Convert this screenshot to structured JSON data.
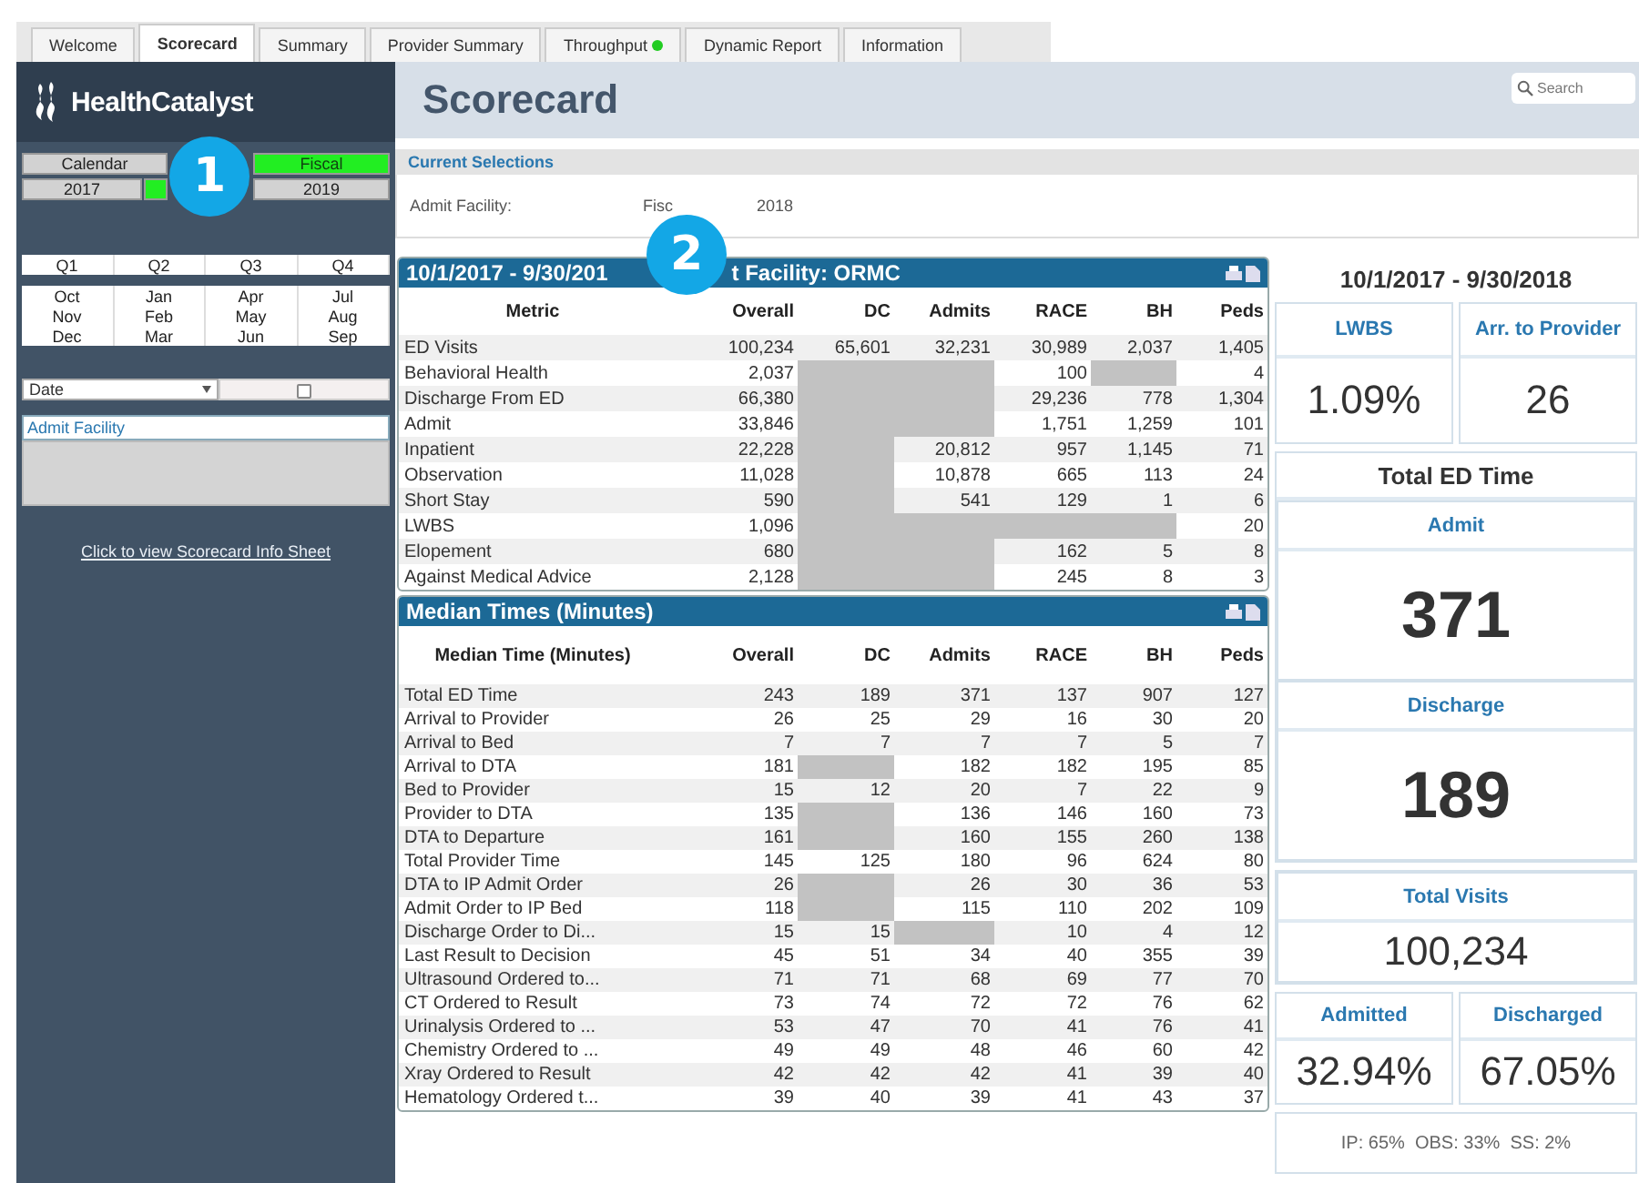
{
  "tabs": [
    {
      "label": "Welcome",
      "selected": false
    },
    {
      "label": "Scorecard",
      "selected": true
    },
    {
      "label": "Summary",
      "selected": false
    },
    {
      "label": "Provider Summary",
      "selected": false
    },
    {
      "label": "Throughput",
      "selected": false,
      "color": "#22cc22"
    },
    {
      "label": "Dynamic Report",
      "selected": false
    },
    {
      "label": "Information",
      "selected": false
    }
  ],
  "sidebar": {
    "logo": "HealthCatalyst",
    "period_toggle": [
      {
        "label": "Calendar",
        "selected": false
      },
      {
        "label": "Fiscal",
        "selected": true
      }
    ],
    "years": [
      {
        "label": "2017",
        "selected": false
      },
      {
        "selected": true
      },
      {
        "label": "2019",
        "selected": false
      }
    ],
    "quarters": [
      {
        "label": "Q1",
        "selected": false
      },
      {
        "label": "Q2",
        "selected": false
      },
      {
        "label": "Q3",
        "selected": false
      },
      {
        "label": "Q4",
        "selected": false
      }
    ],
    "months": [
      [
        {
          "label": "Oct",
          "selected": false
        },
        {
          "label": "Jan",
          "selected": false
        },
        {
          "label": "Apr",
          "selected": false
        },
        {
          "label": "Jul",
          "selected": false
        }
      ],
      [
        {
          "label": "Nov",
          "selected": false
        },
        {
          "label": "Feb",
          "selected": false
        },
        {
          "label": "May",
          "selected": false
        },
        {
          "label": "Aug",
          "selected": false
        }
      ],
      [
        {
          "label": "Dec",
          "selected": false
        },
        {
          "label": "Mar",
          "selected": false
        },
        {
          "label": "Jun",
          "selected": false
        },
        {
          "label": "Sep",
          "selected": false
        }
      ]
    ],
    "date_dropdown": {
      "value": "Date",
      "level": 0.5
    },
    "list_box": {
      "heading": "Admit Facility"
    },
    "link": "Click to view Scorecard Info Sheet"
  },
  "header": {
    "title": "Scorecard",
    "search": {
      "placeholder": "Search"
    }
  },
  "current_selections": {
    "heading": "Current Selections",
    "field": "Admit Facility:",
    "value_parts": [
      "Fisc",
      "2018"
    ]
  },
  "tables": [
    {
      "title_parts": [
        "10/1/2017 - 9/30/201",
        "t Facility: ORMC"
      ],
      "columns": [
        "Metric",
        "Overall",
        "DC",
        "Admits",
        "RACE",
        "BH",
        "Peds"
      ],
      "rows": [
        [
          "ED Visits",
          "100,234",
          "65,601",
          "32,231",
          "30,989",
          "2,037",
          "1,405"
        ],
        [
          "Behavioral Health",
          "2,037",
          null,
          null,
          "100",
          null,
          "4"
        ],
        [
          "Discharge From ED",
          "66,380",
          null,
          null,
          "29,236",
          "778",
          "1,304"
        ],
        [
          "Admit",
          "33,846",
          null,
          null,
          "1,751",
          "1,259",
          "101"
        ],
        [
          "Inpatient",
          "22,228",
          null,
          "20,812",
          "957",
          "1,145",
          "71"
        ],
        [
          "Observation",
          "11,028",
          null,
          "10,878",
          "665",
          "113",
          "24"
        ],
        [
          "Short Stay",
          "590",
          null,
          "541",
          "129",
          "1",
          "6"
        ],
        [
          "LWBS",
          "1,096",
          null,
          null,
          null,
          null,
          "20"
        ],
        [
          "Elopement",
          "680",
          null,
          null,
          "162",
          "5",
          "8"
        ],
        [
          "Against Medical Advice",
          "2,128",
          null,
          null,
          "245",
          "8",
          "3"
        ]
      ]
    },
    {
      "title_parts": [
        "Median Times (Minutes)"
      ],
      "columns": [
        "Median Time (Minutes)",
        "Overall",
        "DC",
        "Admits",
        "RACE",
        "BH",
        "Peds"
      ],
      "rows": [
        [
          "Total ED Time",
          "243",
          "189",
          "371",
          "137",
          "907",
          "127"
        ],
        [
          "Arrival to Provider",
          "26",
          "25",
          "29",
          "16",
          "30",
          "20"
        ],
        [
          "Arrival to Bed",
          "7",
          "7",
          "7",
          "7",
          "5",
          "7"
        ],
        [
          "Arrival to DTA",
          "181",
          null,
          "182",
          "182",
          "195",
          "85"
        ],
        [
          "Bed to Provider",
          "15",
          "12",
          "20",
          "7",
          "22",
          "9"
        ],
        [
          "Provider to DTA",
          "135",
          null,
          "136",
          "146",
          "160",
          "73"
        ],
        [
          "DTA to Departure",
          "161",
          null,
          "160",
          "155",
          "260",
          "138"
        ],
        [
          "Total Provider Time",
          "145",
          "125",
          "180",
          "96",
          "624",
          "80"
        ],
        [
          "DTA to IP Admit Order",
          "26",
          null,
          "26",
          "30",
          "36",
          "53"
        ],
        [
          "Admit Order to IP Bed",
          "118",
          null,
          "115",
          "110",
          "202",
          "109"
        ],
        [
          "Discharge Order to Di...",
          "15",
          "15",
          null,
          "10",
          "4",
          "12"
        ],
        [
          "Last Result to Decision",
          "45",
          "51",
          "34",
          "40",
          "355",
          "39"
        ],
        [
          "Ultrasound Ordered to...",
          "71",
          "71",
          "68",
          "69",
          "77",
          "70"
        ],
        [
          "CT Ordered to Result",
          "73",
          "74",
          "72",
          "72",
          "76",
          "62"
        ],
        [
          "Urinalysis Ordered to ...",
          "53",
          "47",
          "70",
          "41",
          "76",
          "41"
        ],
        [
          "Chemistry Ordered to ...",
          "49",
          "49",
          "48",
          "46",
          "60",
          "42"
        ],
        [
          "Xray Ordered to Result",
          "42",
          "42",
          "42",
          "41",
          "39",
          "40"
        ],
        [
          "Hematology Ordered t...",
          "39",
          "40",
          "39",
          "41",
          "43",
          "37"
        ]
      ]
    }
  ],
  "kpi_panel": {
    "date_range": "10/1/2017 - 9/30/2018",
    "top_pair": [
      {
        "label": "LWBS",
        "value": "1.09%"
      },
      {
        "label": "Arr. to Provider",
        "value": "26"
      }
    ],
    "total_ed_time": {
      "heading": "Total ED Time",
      "items": [
        {
          "label": "Admit",
          "value": "371"
        },
        {
          "label": "Discharge",
          "value": "189"
        }
      ]
    },
    "total_visits": {
      "label": "Total Visits",
      "value": "100,234"
    },
    "bottom_pair": [
      {
        "label": "Admitted",
        "value": "32.94%"
      },
      {
        "label": "Discharged",
        "value": "67.05%"
      }
    ],
    "footnote": "IP: 65%  OBS: 33%  SS: 2%"
  },
  "callouts": [
    {
      "label": "1"
    },
    {
      "label": "2"
    }
  ]
}
